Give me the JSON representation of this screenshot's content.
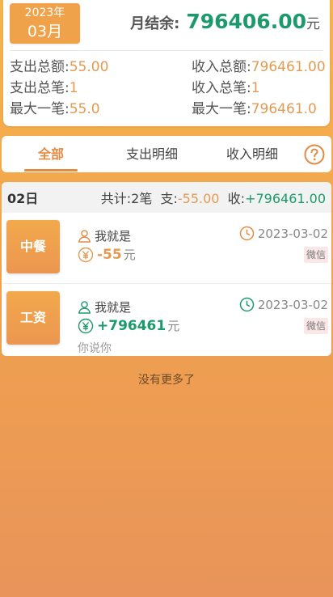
{
  "summary": {
    "year": "2023年",
    "month": "03月",
    "balance_label": "月结余:",
    "balance_value": "796406.00",
    "balance_unit": "元",
    "expense_total_label": "支出总额:",
    "expense_total_value": "55.00",
    "expense_count_label": "支出总笔:",
    "expense_count_value": "1",
    "expense_max_label": "最大一笔:",
    "expense_max_value": "55.0",
    "income_total_label": "收入总额:",
    "income_total_value": "796461.00",
    "income_count_label": "收入总笔:",
    "income_count_value": "1",
    "income_max_label": "最大一笔:",
    "income_max_value": "796461.0"
  },
  "tabs": {
    "all": "全部",
    "expense": "支出明细",
    "income": "收入明细"
  },
  "day": {
    "label": "02日",
    "count_text": "共计:2笔",
    "out_label": "支:",
    "out_value": "-55.00",
    "in_label": "收:",
    "in_value": "+796461.00"
  },
  "entries": [
    {
      "category": "中餐",
      "person": "我就是",
      "amount": "-55",
      "unit": "元",
      "date": "2023-03-02",
      "pay_method": "微信",
      "note": "",
      "color": "#e39a52"
    },
    {
      "category": "工资",
      "person": "我就是",
      "amount": "+796461",
      "unit": "元",
      "date": "2023-03-02",
      "pay_method": "微信",
      "note": "你说你",
      "color": "#1d9a6c"
    }
  ],
  "footer": {
    "no_more": "没有更多了"
  },
  "colors": {
    "accent": "#e38a45",
    "income": "#1d9a6c",
    "expense": "#e39a52"
  }
}
